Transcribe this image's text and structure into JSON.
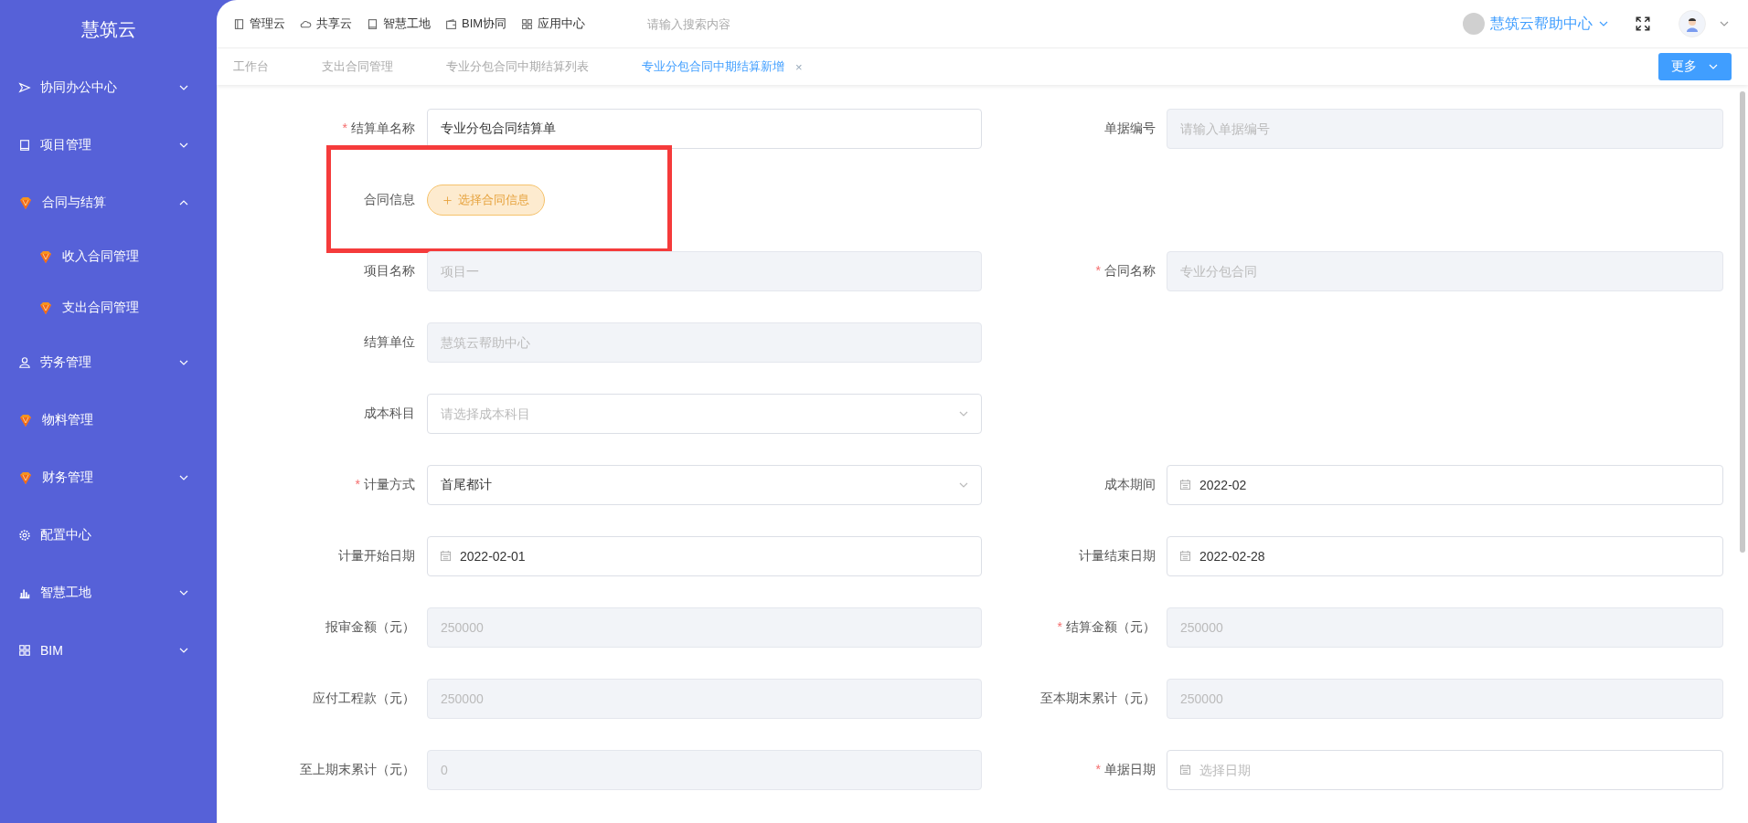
{
  "sidebar": {
    "logo": "慧筑云",
    "items": [
      {
        "label": "协同办公中心",
        "expanded": false
      },
      {
        "label": "项目管理",
        "expanded": false
      },
      {
        "label": "合同与结算",
        "expanded": true,
        "children": [
          {
            "label": "收入合同管理"
          },
          {
            "label": "支出合同管理"
          }
        ]
      },
      {
        "label": "劳务管理",
        "expanded": false
      },
      {
        "label": "物料管理"
      },
      {
        "label": "财务管理",
        "expanded": false
      },
      {
        "label": "配置中心"
      },
      {
        "label": "智慧工地",
        "expanded": false
      },
      {
        "label": "BIM",
        "expanded": false
      }
    ]
  },
  "top_nav": {
    "links": [
      "管理云",
      "共享云",
      "智慧工地",
      "BIM协同",
      "应用中心"
    ],
    "search": {
      "placeholder": "请输入搜索内容"
    },
    "help_center": "慧筑云帮助中心"
  },
  "tabs": [
    {
      "label": "工作台",
      "selected": false
    },
    {
      "label": "支出合同管理",
      "selected": false
    },
    {
      "label": "专业分包合同中期结算列表",
      "selected": false
    },
    {
      "label": "专业分包合同中期结算新增",
      "selected": true,
      "close": "×"
    }
  ],
  "more_button": "更多",
  "form": {
    "rows": [
      {
        "left": {
          "label": "结算单名称",
          "required_mark": "*",
          "kind": "text",
          "value": "专业分包合同结算单",
          "disabled": false
        },
        "right": {
          "label": "单据编号",
          "kind": "text",
          "placeholder": "请输入单据编号",
          "disabled": true
        }
      },
      {
        "highlighted": true,
        "left": {
          "label": "合同信息",
          "kind": "button",
          "value": "选择合同信息"
        }
      },
      {
        "left": {
          "label": "项目名称",
          "kind": "text",
          "placeholder": "项目一",
          "disabled": true
        },
        "right": {
          "label": "合同名称",
          "required_mark": "*",
          "kind": "text",
          "placeholder": "专业分包合同",
          "disabled": true
        }
      },
      {
        "left": {
          "label": "结算单位",
          "kind": "text",
          "placeholder": "慧筑云帮助中心",
          "disabled": true
        }
      },
      {
        "left": {
          "label": "成本科目",
          "kind": "select",
          "placeholder": "请选择成本科目",
          "disabled": false
        }
      },
      {
        "left": {
          "label": "计量方式",
          "required_mark": "*",
          "kind": "select",
          "value": "首尾都计",
          "disabled": false
        },
        "right": {
          "label": "成本期间",
          "kind": "date",
          "value": "2022-02",
          "disabled": false
        }
      },
      {
        "left": {
          "label": "计量开始日期",
          "kind": "date",
          "value": "2022-02-01",
          "disabled": false
        },
        "right": {
          "label": "计量结束日期",
          "kind": "date",
          "value": "2022-02-28",
          "disabled": false
        }
      },
      {
        "left": {
          "label": "报审金额（元）",
          "kind": "text",
          "placeholder": "250000",
          "disabled": true
        },
        "right": {
          "label": "结算金额（元）",
          "required_mark": "*",
          "kind": "text",
          "placeholder": "250000",
          "disabled": true
        }
      },
      {
        "left": {
          "label": "应付工程款（元）",
          "kind": "text",
          "placeholder": "250000",
          "disabled": true
        },
        "right": {
          "label": "至本期末累计（元）",
          "kind": "text",
          "placeholder": "250000",
          "disabled": true
        }
      },
      {
        "left": {
          "label": "至上期末累计（元）",
          "kind": "text",
          "placeholder": "0",
          "disabled": true
        },
        "right": {
          "label": "单据日期",
          "required_mark": "*",
          "kind": "date",
          "placeholder": "选择日期",
          "disabled": false
        }
      }
    ]
  }
}
